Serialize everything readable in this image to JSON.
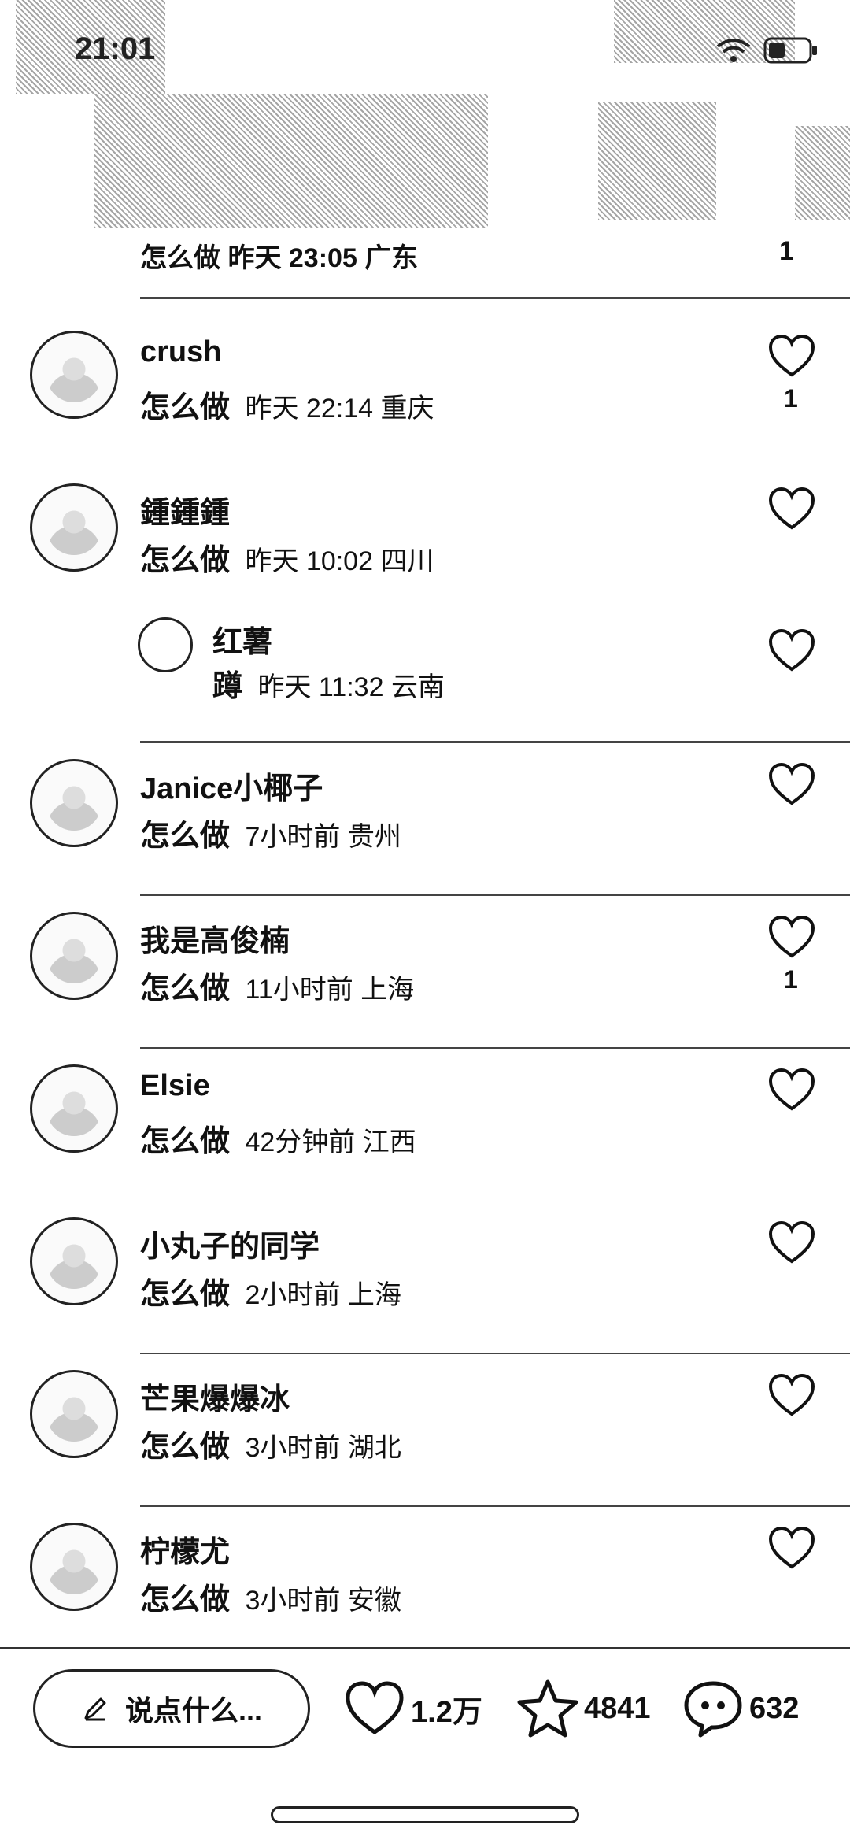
{
  "status_bar": {
    "time": "21:01"
  },
  "top_comment": {
    "meta": "怎么做 昨天 23:05 广东",
    "likes": "1"
  },
  "comments": [
    {
      "name": "crush",
      "keyword": "怎么做",
      "time": "昨天 22:14",
      "region": "重庆",
      "likes": "1"
    },
    {
      "name": "鍾鍾鍾",
      "keyword": "怎么做",
      "time": "昨天 10:02",
      "region": "四川",
      "likes": "",
      "reply": {
        "name": "红薯",
        "keyword": "蹲",
        "time": "昨天 11:32",
        "region": "云南"
      }
    },
    {
      "name": "Janice小椰子",
      "keyword": "怎么做",
      "time": "7小时前",
      "region": "贵州",
      "likes": ""
    },
    {
      "name": "我是高俊楠",
      "keyword": "怎么做",
      "time": "11小时前",
      "region": "上海",
      "likes": "1"
    },
    {
      "name": "Elsie",
      "keyword": "怎么做",
      "time": "42分钟前",
      "region": "江西",
      "likes": ""
    },
    {
      "name": "小丸子的同学",
      "keyword": "怎么做",
      "time": "2小时前",
      "region": "上海",
      "likes": ""
    },
    {
      "name": "芒果爆爆冰",
      "keyword": "怎么做",
      "time": "3小时前",
      "region": "湖北",
      "likes": ""
    },
    {
      "name": "柠檬尤",
      "keyword": "怎么做",
      "time": "3小时前",
      "region": "安徽",
      "likes": ""
    }
  ],
  "bottom_bar": {
    "input_placeholder": "说点什么...",
    "likes": "1.2万",
    "favorites": "4841",
    "comments": "632"
  }
}
